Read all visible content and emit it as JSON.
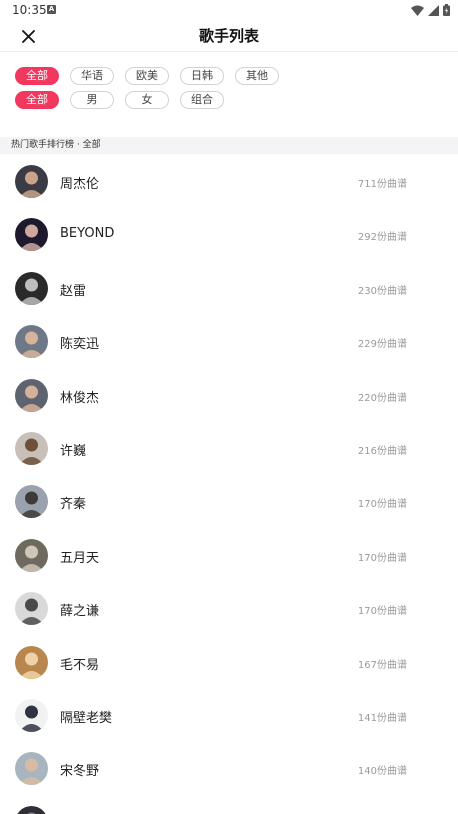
{
  "status": {
    "time": "10:35",
    "notif_glyph": "A",
    "icons": [
      "wifi-icon",
      "cellular-signal-icon",
      "battery-icon"
    ]
  },
  "header": {
    "title": "歌手列表",
    "close_icon": "close-icon"
  },
  "filters": {
    "category": [
      {
        "label": "全部",
        "active": true
      },
      {
        "label": "华语",
        "active": false
      },
      {
        "label": "欧美",
        "active": false
      },
      {
        "label": "日韩",
        "active": false
      },
      {
        "label": "其他",
        "active": false
      }
    ],
    "type": [
      {
        "label": "全部",
        "active": true
      },
      {
        "label": "男",
        "active": false
      },
      {
        "label": "女",
        "active": false
      },
      {
        "label": "组合",
        "active": false
      }
    ]
  },
  "section": {
    "title": "热门歌手排行榜 · 全部"
  },
  "colors": {
    "accent": "#f2385e",
    "muted": "#9a9a9a",
    "section_bg": "#f4f4f6"
  },
  "singers": [
    {
      "name": "周杰伦",
      "count": "711份曲谱",
      "avatar_bg": "#3b3b46",
      "avatar_fg": "#c9a48a"
    },
    {
      "name": "BEYOND",
      "count": "292份曲谱",
      "avatar_bg": "#1d1a2e",
      "avatar_fg": "#cfa8a0"
    },
    {
      "name": "赵雷",
      "count": "230份曲谱",
      "avatar_bg": "#2a2a2a",
      "avatar_fg": "#bdbdbd"
    },
    {
      "name": "陈奕迅",
      "count": "229份曲谱",
      "avatar_bg": "#6f7886",
      "avatar_fg": "#d7b39a"
    },
    {
      "name": "林俊杰",
      "count": "220份曲谱",
      "avatar_bg": "#5d6470",
      "avatar_fg": "#d5b09a"
    },
    {
      "name": "许巍",
      "count": "216份曲谱",
      "avatar_bg": "#c6c0b8",
      "avatar_fg": "#6d4f3a"
    },
    {
      "name": "齐秦",
      "count": "170份曲谱",
      "avatar_bg": "#9aa2ad",
      "avatar_fg": "#3e3a38"
    },
    {
      "name": "五月天",
      "count": "170份曲谱",
      "avatar_bg": "#6f6a5f",
      "avatar_fg": "#cfc7b8"
    },
    {
      "name": "薛之谦",
      "count": "170份曲谱",
      "avatar_bg": "#d9d9d9",
      "avatar_fg": "#4a4a4a"
    },
    {
      "name": "毛不易",
      "count": "167份曲谱",
      "avatar_bg": "#b9874e",
      "avatar_fg": "#f0d2a8"
    },
    {
      "name": "隔壁老樊",
      "count": "141份曲谱",
      "avatar_bg": "#f2f2f2",
      "avatar_fg": "#2f3442"
    },
    {
      "name": "宋冬野",
      "count": "140份曲谱",
      "avatar_bg": "#a8b4bf",
      "avatar_fg": "#d8bba3"
    },
    {
      "name": "",
      "count": "",
      "avatar_bg": "#2e3036",
      "avatar_fg": "#7d7f86"
    }
  ]
}
